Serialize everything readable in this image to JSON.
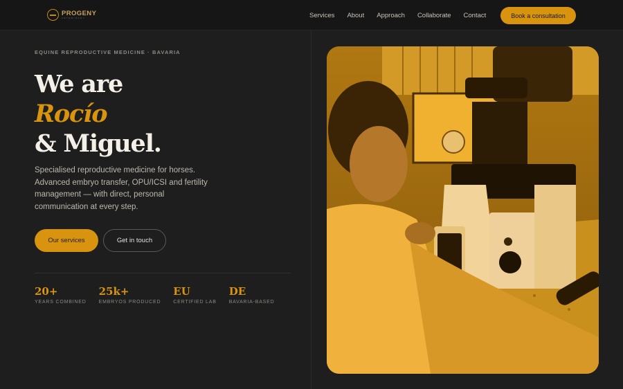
{
  "brand": {
    "name": "PROGENY",
    "tagline": "VETERINARY"
  },
  "nav": {
    "links": [
      "Services",
      "About",
      "Approach",
      "Collaborate",
      "Contact"
    ],
    "cta": "Book a consultation"
  },
  "hero": {
    "eyebrow": "EQUINE REPRODUCTIVE MEDICINE · BAVARIA",
    "line1": "We are",
    "line2": "Rocío",
    "line3": "& Miguel.",
    "description": "Specialised reproductive medicine for horses. Advanced embryo transfer, OPU/ICSI and fertility management — with direct, personal communication at every step.",
    "primary_button": "Our services",
    "secondary_button": "Get in touch"
  },
  "stats": [
    {
      "value": "20+",
      "label": "YEARS COMBINED"
    },
    {
      "value": "25k+",
      "label": "EMBRYOS PRODUCED"
    },
    {
      "value": "EU",
      "label": "CERTIFIED LAB"
    },
    {
      "value": "DE",
      "label": "BAVARIA-BASED"
    }
  ],
  "colors": {
    "accent": "#d9940f",
    "background": "#1e1e1e",
    "nav_background": "#161616",
    "text": "#f4f0e8"
  },
  "image": {
    "subject": "veterinarian-at-microscope-photo"
  }
}
